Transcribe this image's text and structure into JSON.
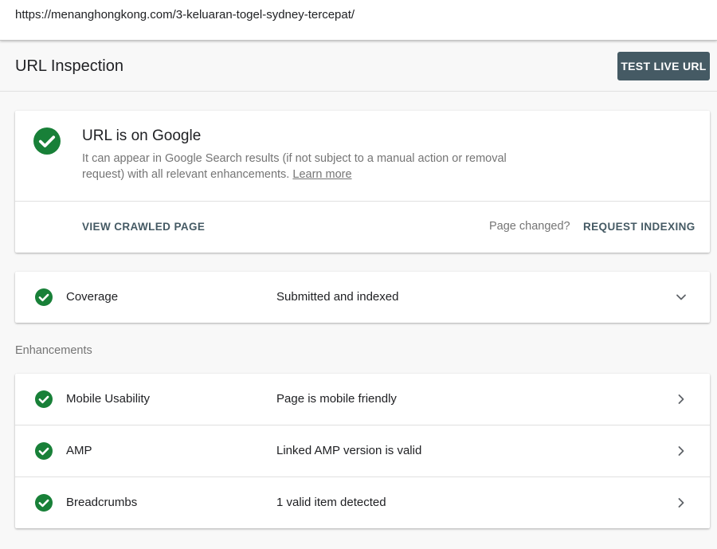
{
  "url_bar": {
    "url": "https://menanghongkong.com/3-keluaran-togel-sydney-tercepat/"
  },
  "header": {
    "title": "URL Inspection",
    "test_live_label": "TEST LIVE URL"
  },
  "status": {
    "title": "URL is on Google",
    "description": "It can appear in Google Search results (if not subject to a manual action or removal request) with all relevant enhancements.",
    "learn_more": "Learn more",
    "view_crawled_label": "VIEW CRAWLED PAGE",
    "page_changed_text": "Page changed?",
    "request_indexing_label": "REQUEST INDEXING",
    "icon": "check-circle-icon"
  },
  "coverage": {
    "label": "Coverage",
    "value": "Submitted and indexed",
    "icon": "check-circle-icon",
    "chevron": "chevron-down-icon"
  },
  "enhancements": {
    "section_label": "Enhancements",
    "items": [
      {
        "label": "Mobile Usability",
        "value": "Page is mobile friendly"
      },
      {
        "label": "AMP",
        "value": "Linked AMP version is valid"
      },
      {
        "label": "Breadcrumbs",
        "value": "1 valid item detected"
      }
    ]
  },
  "colors": {
    "success_green": "#188038",
    "primary_button": "#455a64",
    "page_background": "#f8f8f8"
  }
}
